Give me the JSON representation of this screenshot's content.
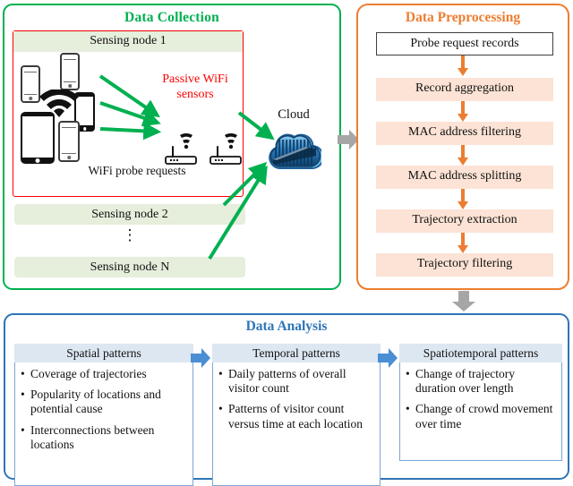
{
  "collection": {
    "title": "Data Collection",
    "node1_label": "Sensing node 1",
    "node2_label": "Sensing node 2",
    "nodeN_label": "Sensing node N",
    "ellipsis": "⋮",
    "sensors_label": "Passive WiFi sensors",
    "probe_label": "WiFi probe requests",
    "cloud_label": "Cloud",
    "border_color": "#00b050",
    "node_border_color": "#ff0000",
    "node_fill_color": "#e6eedc",
    "arrow_color": "#00b050",
    "sensors_text_color": "#ff0000"
  },
  "preprocessing": {
    "title": "Data Preprocessing",
    "border_color": "#ed7d31",
    "step_fill_color": "#fce3d5",
    "arrow_color": "#ed7d31",
    "steps": [
      "Probe request records",
      "Record aggregation",
      "MAC address filtering",
      "MAC address splitting",
      "Trajectory extraction",
      "Trajectory filtering"
    ]
  },
  "connectors": {
    "collection_to_preprocessing": "right-arrow",
    "preprocessing_to_analysis": "down-arrow",
    "color": "#a6a6a6"
  },
  "analysis": {
    "title": "Data Analysis",
    "border_color": "#2e75b6",
    "header_fill_color": "#dde7f2",
    "arrow_color": "#4a8ed4",
    "columns": [
      {
        "header": "Spatial patterns",
        "items": [
          "Coverage of trajectories",
          "Popularity of locations and potential cause",
          "Interconnections between locations"
        ]
      },
      {
        "header": "Temporal patterns",
        "items": [
          "Daily patterns of overall visitor count",
          "Patterns of visitor count versus time at each location"
        ]
      },
      {
        "header": "Spatiotemporal patterns",
        "items": [
          "Change of trajectory duration over length",
          "Change of crowd movement over time"
        ]
      }
    ]
  }
}
